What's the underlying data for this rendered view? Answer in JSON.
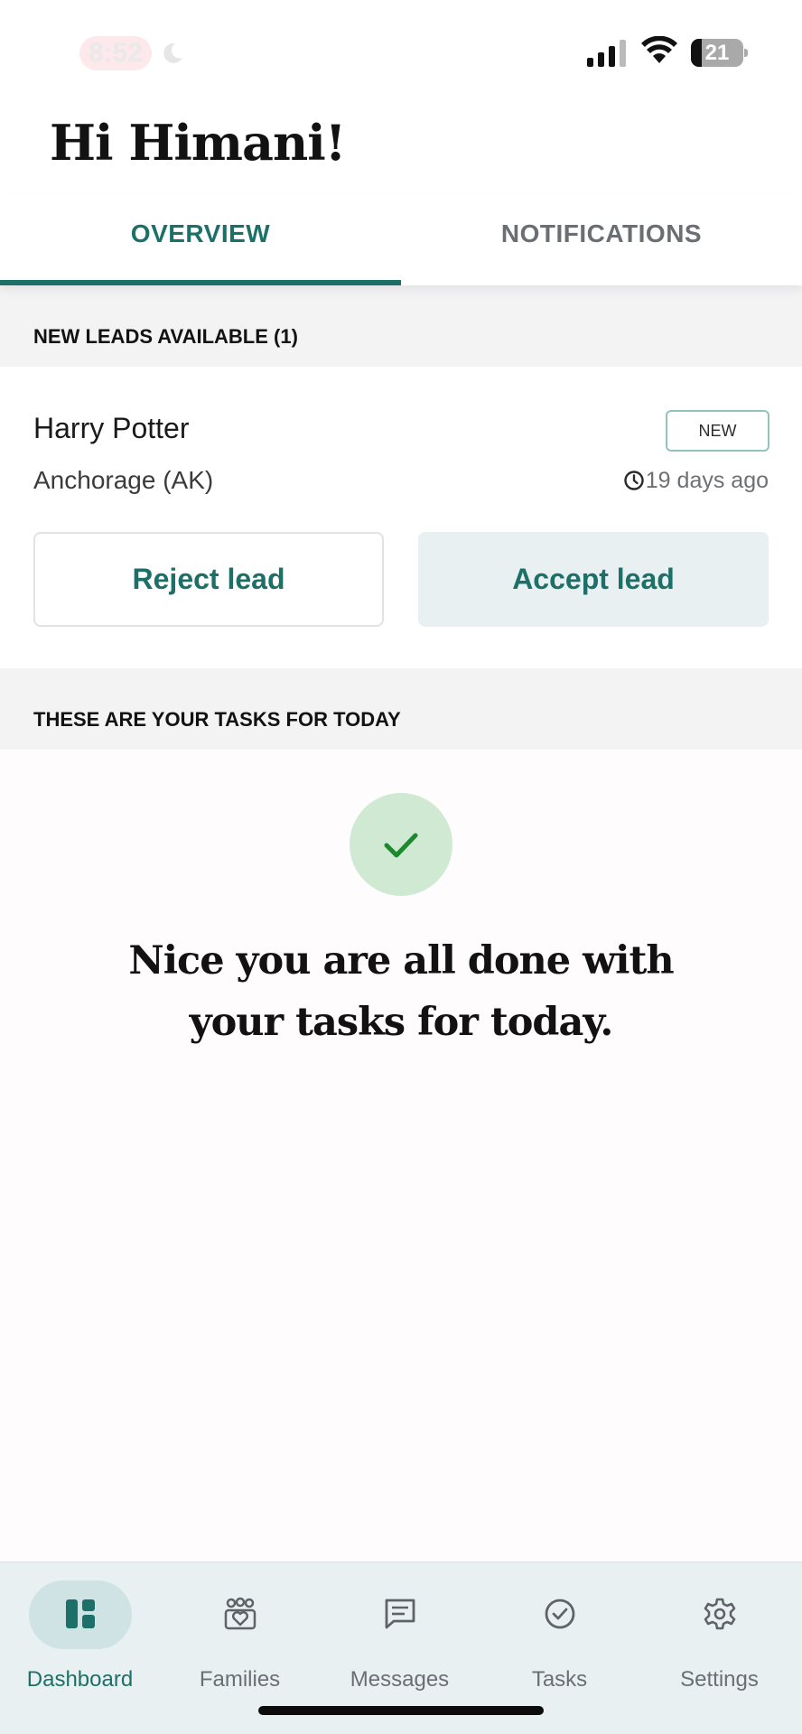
{
  "status_bar": {
    "time": "8:52",
    "battery": "21",
    "battery_level": 0.21
  },
  "header": {
    "greeting": "Hi Himani!"
  },
  "tabs": [
    {
      "label": "OVERVIEW",
      "active": true
    },
    {
      "label": "NOTIFICATIONS",
      "active": false
    }
  ],
  "leads": {
    "title": "NEW LEADS AVAILABLE (1)",
    "items": [
      {
        "name": "Harry Potter",
        "location": "Anchorage (AK)",
        "badge": "NEW",
        "time_ago": "19 days ago",
        "reject_label": "Reject lead",
        "accept_label": "Accept lead"
      }
    ]
  },
  "tasks": {
    "title": "THESE ARE YOUR TASKS FOR TODAY",
    "done_message": "Nice you are all done with your tasks for today."
  },
  "bottom_nav": [
    {
      "label": "Dashboard",
      "icon": "dashboard-icon",
      "active": true
    },
    {
      "label": "Families",
      "icon": "families-icon",
      "active": false
    },
    {
      "label": "Messages",
      "icon": "messages-icon",
      "active": false
    },
    {
      "label": "Tasks",
      "icon": "tasks-icon",
      "active": false
    },
    {
      "label": "Settings",
      "icon": "settings-icon",
      "active": false
    }
  ],
  "colors": {
    "accent": "#1d7067",
    "success": "#1a8a2c",
    "muted": "#6b6f73"
  }
}
